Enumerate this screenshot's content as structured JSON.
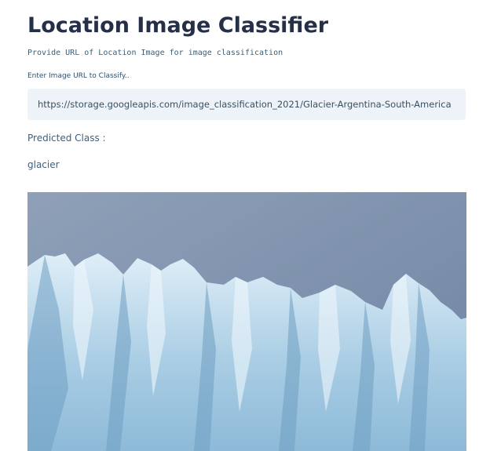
{
  "header": {
    "title": "Location Image Classifier",
    "subtitle": "Provide URL of Location Image for image classification"
  },
  "form": {
    "url_label": "Enter Image URL to Classify..",
    "url_value": "https://storage.googleapis.com/image_classification_2021/Glacier-Argentina-South-America"
  },
  "result": {
    "label": "Predicted Class :",
    "value": "glacier"
  },
  "image": {
    "subject": "glacier-photo",
    "colors": {
      "sky_top": "#8fa0b8",
      "sky_bottom": "#6f84a3",
      "ice_light": "#dfeef8",
      "ice_mid": "#a9cde4",
      "ice_shadow": "#6f9fc2"
    }
  }
}
